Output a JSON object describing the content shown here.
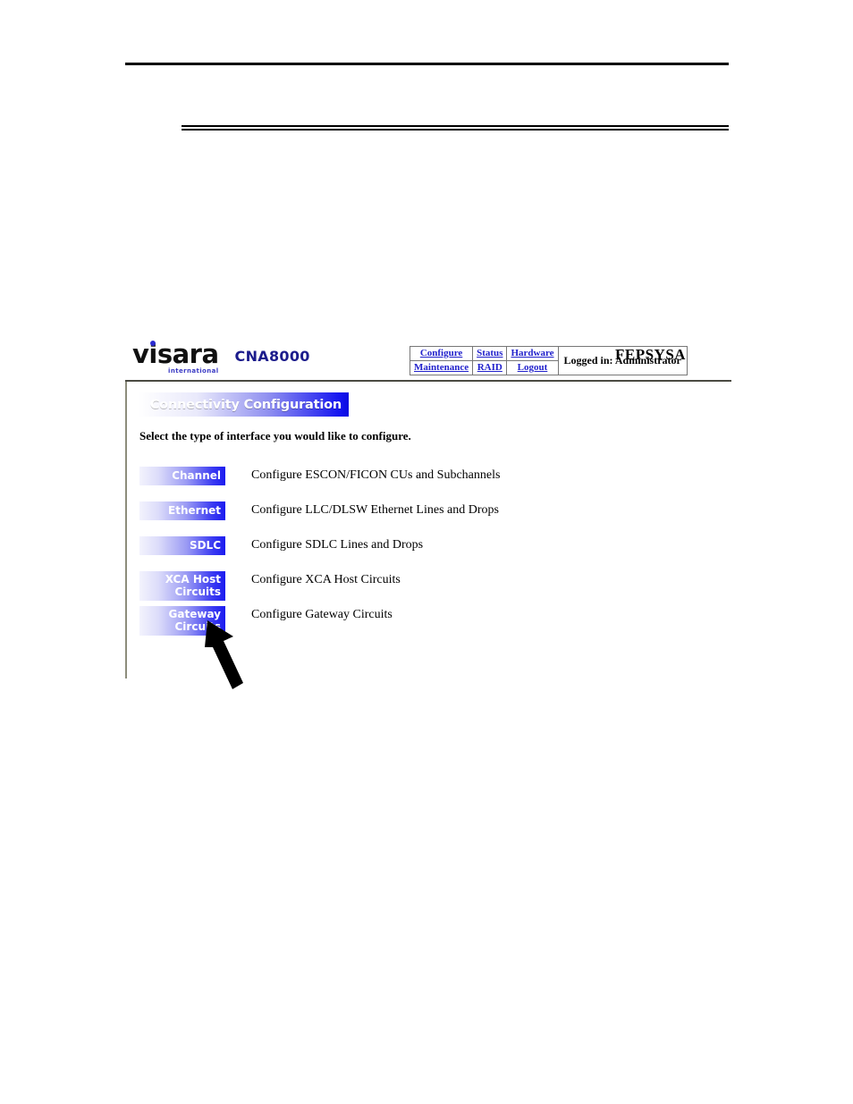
{
  "document": {
    "rule_top": "horizontal-rule",
    "rule_double": "double-horizontal-rule"
  },
  "app": {
    "brand": {
      "logo_text": "visara",
      "logo_subtext": "international",
      "product": "CNA8000"
    },
    "nav": {
      "rows": [
        [
          {
            "label": "Configure",
            "name": "nav-link-configure"
          },
          {
            "label": "Status",
            "name": "nav-link-status"
          },
          {
            "label": "Hardware",
            "name": "nav-link-hardware"
          }
        ],
        [
          {
            "label": "Maintenance",
            "name": "nav-link-maintenance"
          },
          {
            "label": "RAID",
            "name": "nav-link-raid"
          },
          {
            "label": "Logout",
            "name": "nav-link-logout"
          }
        ]
      ],
      "logged_in": "Logged in: Administrator"
    },
    "system_name": "FEPSYSA",
    "page": {
      "banner_title": "Connectivity Configuration",
      "instruction": "Select the type of interface you would like to configure.",
      "interfaces": [
        {
          "button_label": "Channel",
          "button_label_line2": "",
          "description": "Configure ESCON/FICON CUs and Subchannels"
        },
        {
          "button_label": "Ethernet",
          "button_label_line2": "",
          "description": "Configure LLC/DLSW Ethernet Lines and Drops"
        },
        {
          "button_label": "SDLC",
          "button_label_line2": "",
          "description": "Configure SDLC Lines and Drops"
        },
        {
          "button_label": "XCA Host",
          "button_label_line2": "Circuits",
          "description": "Configure XCA Host Circuits"
        },
        {
          "button_label": "Gateway",
          "button_label_line2": "Circuits",
          "description": "Configure Gateway Circuits"
        }
      ]
    }
  },
  "annotation": {
    "arrow": "callout-arrow-pointing-to-gateway-circuits"
  },
  "colors": {
    "link_blue": "#2222cc",
    "brand_blue": "#1c1c8c",
    "gradient_end_blue": "#1b1bf0",
    "divider_gray": "#8d8d7c"
  }
}
